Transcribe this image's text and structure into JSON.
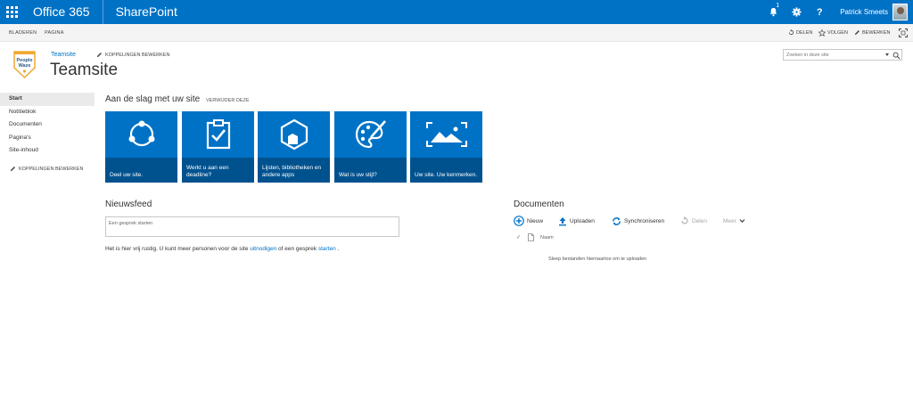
{
  "suitebar": {
    "brand": "Office 365",
    "app": "SharePoint",
    "notification_count": "1",
    "user_name": "Patrick Smeets"
  },
  "ribbon": {
    "tabs": [
      "BLADEREN",
      "PAGINA"
    ],
    "share": "DELEN",
    "follow": "VOLGEN",
    "edit": "BEWERKEN"
  },
  "header": {
    "logo_text": "People Waze",
    "site_link": "Teamsite",
    "edit_links": "KOPPELINGEN BEWERKEN",
    "title": "Teamsite"
  },
  "search": {
    "placeholder": "Zoeken in deze site"
  },
  "quicklaunch": {
    "items": [
      {
        "label": "Start"
      },
      {
        "label": "Notitieblok"
      },
      {
        "label": "Documenten"
      },
      {
        "label": "Pagina's"
      },
      {
        "label": "Site-inhoud"
      }
    ],
    "edit_links": "KOPPELINGEN BEWERKEN"
  },
  "getting_started": {
    "title": "Aan de slag met uw site",
    "remove": "VERWIJDER DEZE",
    "tiles": [
      {
        "label": "Deel uw site."
      },
      {
        "label": "Werkt u aan een deadline?"
      },
      {
        "label": "Lijsten, bibliotheken en andere apps"
      },
      {
        "label": "Wat is uw stijl?"
      },
      {
        "label": "Uw site. Uw kenmerken."
      }
    ]
  },
  "newsfeed": {
    "title": "Nieuwsfeed",
    "placeholder": "Een gesprek starten",
    "text_before": "Het is hier vrij rustig. U kunt meer personen voor de site ",
    "link_invite": "uitnodigen",
    "text_middle": " of een gesprek ",
    "link_start": "starten",
    "text_after": " ."
  },
  "documents": {
    "title": "Documenten",
    "commands": {
      "new": "Nieuw",
      "upload": "Uploaden",
      "sync": "Synchroniseren",
      "share": "Delen",
      "more": "Meer"
    },
    "column_name": "Naam",
    "empty_text": "Sleep bestanden hiernaartoe om te uploaden"
  },
  "colors": {
    "suitebar": "#0072c6",
    "tile": "#0072c6",
    "link": "#0072c6"
  },
  "icons": [
    "waffle-icon",
    "bell-icon",
    "gear-icon",
    "help-icon",
    "share-icon",
    "star-icon",
    "pencil-icon",
    "focus-icon",
    "search-icon",
    "plus-circle-icon",
    "upload-icon",
    "sync-icon",
    "checkmark-icon",
    "file-icon",
    "chevron-down-icon"
  ]
}
